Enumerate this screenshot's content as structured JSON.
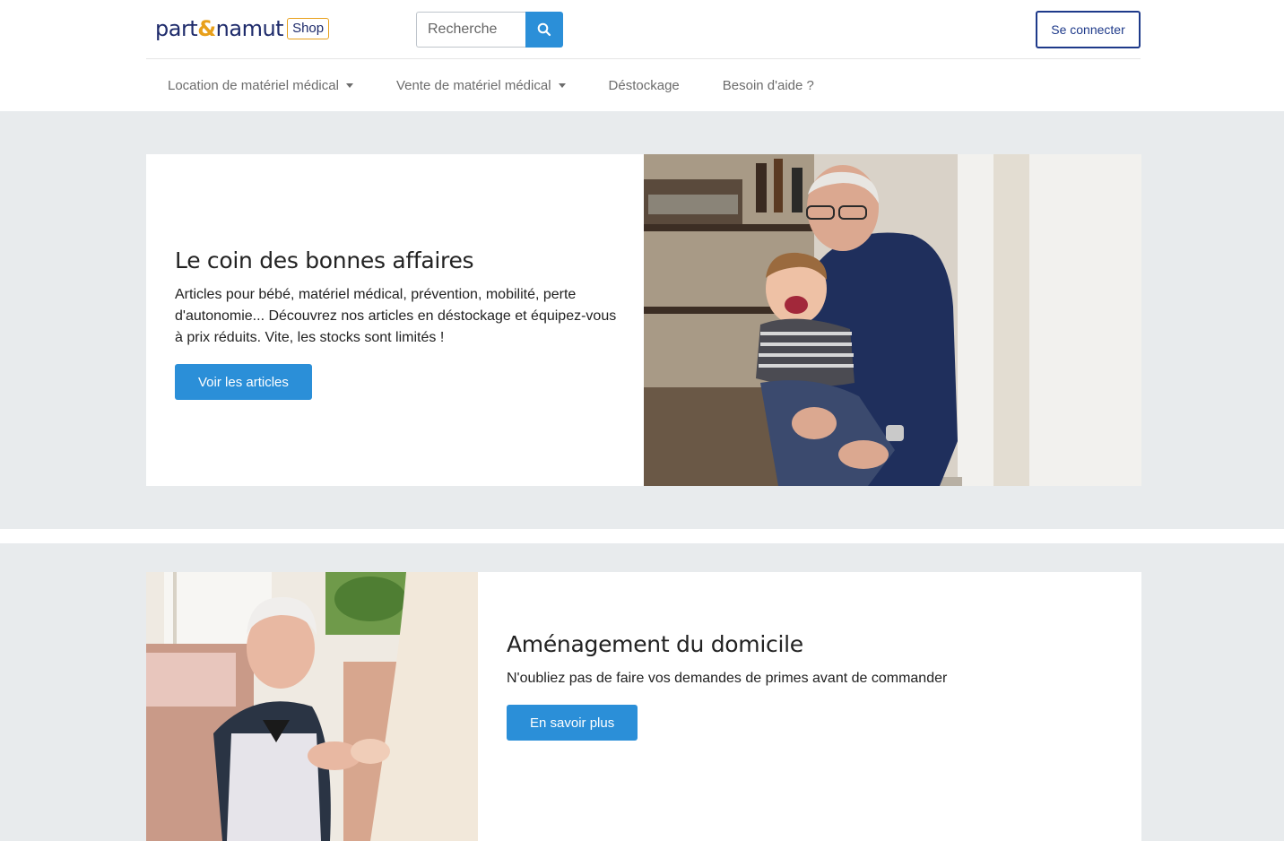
{
  "header": {
    "logo_part1": "part",
    "logo_amp": "&",
    "logo_part2": "namut",
    "logo_badge": "Shop",
    "search_placeholder": "Recherche",
    "login_label": "Se connecter"
  },
  "nav": {
    "items": [
      {
        "label": "Location de matériel médical",
        "has_dropdown": true
      },
      {
        "label": "Vente de matériel médical",
        "has_dropdown": true
      },
      {
        "label": "Déstockage",
        "has_dropdown": false
      },
      {
        "label": "Besoin d'aide ?",
        "has_dropdown": false
      }
    ]
  },
  "promo1": {
    "title": "Le coin des bonnes affaires",
    "description": "Articles pour bébé, matériel médical, prévention, mobilité, perte d'autonomie... Découvrez nos articles en déstockage et équipez-vous à prix réduits. Vite, les stocks sont limités !",
    "button": "Voir les articles"
  },
  "promo2": {
    "title": "Aménagement du domicile",
    "description": "N'oubliez pas de faire vos demandes de primes avant de commander",
    "button": "En savoir plus"
  },
  "colors": {
    "brand_navy": "#1e2b6b",
    "brand_gold": "#e8a01b",
    "accent_blue": "#2b8fd8",
    "section_bg": "#e8ebed"
  }
}
